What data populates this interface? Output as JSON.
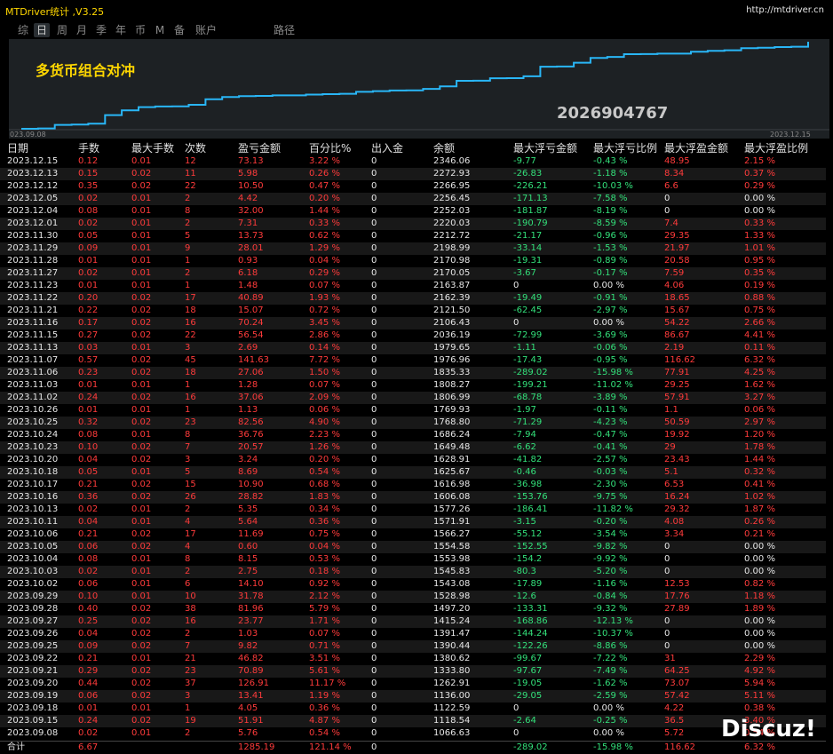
{
  "window": {
    "title": "MTDriver统计 ,V3.25",
    "url": "http://mtdriver.cn"
  },
  "tabs": [
    "综",
    "日",
    "周",
    "月",
    "季",
    "年",
    "币",
    "M",
    "备",
    "账户",
    "路径"
  ],
  "active_tab": "日",
  "chart": {
    "title": "多货币组合对冲",
    "account": "2026904767",
    "start_label": "023.09.08",
    "end_label": "2023.12.15",
    "line_color": "#29b6f6"
  },
  "table": {
    "headers": [
      "日期",
      "手数",
      "最大手数",
      "次数",
      "盈亏金额",
      "百分比%",
      "出入金",
      "余额",
      "最大浮亏金额",
      "最大浮亏比例",
      "最大浮盈金额",
      "最大浮盈比例"
    ],
    "rows": [
      [
        "2023.12.15",
        "0.12",
        "0.01",
        "12",
        "73.13",
        "3.22 %",
        "0",
        "2346.06",
        "-9.77",
        "-0.43 %",
        "48.95",
        "2.15 %"
      ],
      [
        "2023.12.13",
        "0.15",
        "0.02",
        "11",
        "5.98",
        "0.26 %",
        "0",
        "2272.93",
        "-26.83",
        "-1.18 %",
        "8.34",
        "0.37 %"
      ],
      [
        "2023.12.12",
        "0.35",
        "0.02",
        "22",
        "10.50",
        "0.47 %",
        "0",
        "2266.95",
        "-226.21",
        "-10.03 %",
        "6.6",
        "0.29 %"
      ],
      [
        "2023.12.05",
        "0.02",
        "0.01",
        "2",
        "4.42",
        "0.20 %",
        "0",
        "2256.45",
        "-171.13",
        "-7.58 %",
        "0",
        "0.00 %"
      ],
      [
        "2023.12.04",
        "0.08",
        "0.01",
        "8",
        "32.00",
        "1.44 %",
        "0",
        "2252.03",
        "-181.87",
        "-8.19 %",
        "0",
        "0.00 %"
      ],
      [
        "2023.12.01",
        "0.02",
        "0.01",
        "2",
        "7.31",
        "0.33 %",
        "0",
        "2220.03",
        "-190.79",
        "-8.59 %",
        "7.4",
        "0.33 %"
      ],
      [
        "2023.11.30",
        "0.05",
        "0.01",
        "5",
        "13.73",
        "0.62 %",
        "0",
        "2212.72",
        "-21.17",
        "-0.96 %",
        "29.35",
        "1.33 %"
      ],
      [
        "2023.11.29",
        "0.09",
        "0.01",
        "9",
        "28.01",
        "1.29 %",
        "0",
        "2198.99",
        "-33.14",
        "-1.53 %",
        "21.97",
        "1.01 %"
      ],
      [
        "2023.11.28",
        "0.01",
        "0.01",
        "1",
        "0.93",
        "0.04 %",
        "0",
        "2170.98",
        "-19.31",
        "-0.89 %",
        "20.58",
        "0.95 %"
      ],
      [
        "2023.11.27",
        "0.02",
        "0.01",
        "2",
        "6.18",
        "0.29 %",
        "0",
        "2170.05",
        "-3.67",
        "-0.17 %",
        "7.59",
        "0.35 %"
      ],
      [
        "2023.11.23",
        "0.01",
        "0.01",
        "1",
        "1.48",
        "0.07 %",
        "0",
        "2163.87",
        "0",
        "0.00 %",
        "4.06",
        "0.19 %"
      ],
      [
        "2023.11.22",
        "0.20",
        "0.02",
        "17",
        "40.89",
        "1.93 %",
        "0",
        "2162.39",
        "-19.49",
        "-0.91 %",
        "18.65",
        "0.88 %"
      ],
      [
        "2023.11.21",
        "0.22",
        "0.02",
        "18",
        "15.07",
        "0.72 %",
        "0",
        "2121.50",
        "-62.45",
        "-2.97 %",
        "15.67",
        "0.75 %"
      ],
      [
        "2023.11.16",
        "0.17",
        "0.02",
        "16",
        "70.24",
        "3.45 %",
        "0",
        "2106.43",
        "0",
        "0.00 %",
        "54.22",
        "2.66 %"
      ],
      [
        "2023.11.15",
        "0.27",
        "0.02",
        "22",
        "56.54",
        "2.86 %",
        "0",
        "2036.19",
        "-72.99",
        "-3.69 %",
        "86.67",
        "4.41 %"
      ],
      [
        "2023.11.13",
        "0.03",
        "0.01",
        "3",
        "2.69",
        "0.14 %",
        "0",
        "1979.65",
        "-1.11",
        "-0.06 %",
        "2.19",
        "0.11 %"
      ],
      [
        "2023.11.07",
        "0.57",
        "0.02",
        "45",
        "141.63",
        "7.72 %",
        "0",
        "1976.96",
        "-17.43",
        "-0.95 %",
        "116.62",
        "6.32 %"
      ],
      [
        "2023.11.06",
        "0.23",
        "0.02",
        "18",
        "27.06",
        "1.50 %",
        "0",
        "1835.33",
        "-289.02",
        "-15.98 %",
        "77.91",
        "4.25 %"
      ],
      [
        "2023.11.03",
        "0.01",
        "0.01",
        "1",
        "1.28",
        "0.07 %",
        "0",
        "1808.27",
        "-199.21",
        "-11.02 %",
        "29.25",
        "1.62 %"
      ],
      [
        "2023.11.02",
        "0.24",
        "0.02",
        "16",
        "37.06",
        "2.09 %",
        "0",
        "1806.99",
        "-68.78",
        "-3.89 %",
        "57.91",
        "3.27 %"
      ],
      [
        "2023.10.26",
        "0.01",
        "0.01",
        "1",
        "1.13",
        "0.06 %",
        "0",
        "1769.93",
        "-1.97",
        "-0.11 %",
        "1.1",
        "0.06 %"
      ],
      [
        "2023.10.25",
        "0.32",
        "0.02",
        "23",
        "82.56",
        "4.90 %",
        "0",
        "1768.80",
        "-71.29",
        "-4.23 %",
        "50.59",
        "2.97 %"
      ],
      [
        "2023.10.24",
        "0.08",
        "0.01",
        "8",
        "36.76",
        "2.23 %",
        "0",
        "1686.24",
        "-7.94",
        "-0.47 %",
        "19.92",
        "1.20 %"
      ],
      [
        "2023.10.23",
        "0.10",
        "0.02",
        "7",
        "20.57",
        "1.26 %",
        "0",
        "1649.48",
        "-6.62",
        "-0.41 %",
        "29",
        "1.78 %"
      ],
      [
        "2023.10.20",
        "0.04",
        "0.02",
        "3",
        "3.24",
        "0.20 %",
        "0",
        "1628.91",
        "-41.82",
        "-2.57 %",
        "23.43",
        "1.44 %"
      ],
      [
        "2023.10.18",
        "0.05",
        "0.01",
        "5",
        "8.69",
        "0.54 %",
        "0",
        "1625.67",
        "-0.46",
        "-0.03 %",
        "5.1",
        "0.32 %"
      ],
      [
        "2023.10.17",
        "0.21",
        "0.02",
        "15",
        "10.90",
        "0.68 %",
        "0",
        "1616.98",
        "-36.98",
        "-2.30 %",
        "6.53",
        "0.41 %"
      ],
      [
        "2023.10.16",
        "0.36",
        "0.02",
        "26",
        "28.82",
        "1.83 %",
        "0",
        "1606.08",
        "-153.76",
        "-9.75 %",
        "16.24",
        "1.02 %"
      ],
      [
        "2023.10.13",
        "0.02",
        "0.01",
        "2",
        "5.35",
        "0.34 %",
        "0",
        "1577.26",
        "-186.41",
        "-11.82 %",
        "29.32",
        "1.87 %"
      ],
      [
        "2023.10.11",
        "0.04",
        "0.01",
        "4",
        "5.64",
        "0.36 %",
        "0",
        "1571.91",
        "-3.15",
        "-0.20 %",
        "4.08",
        "0.26 %"
      ],
      [
        "2023.10.06",
        "0.21",
        "0.02",
        "17",
        "11.69",
        "0.75 %",
        "0",
        "1566.27",
        "-55.12",
        "-3.54 %",
        "3.34",
        "0.21 %"
      ],
      [
        "2023.10.05",
        "0.06",
        "0.02",
        "4",
        "0.60",
        "0.04 %",
        "0",
        "1554.58",
        "-152.55",
        "-9.82 %",
        "0",
        "0.00 %"
      ],
      [
        "2023.10.04",
        "0.08",
        "0.01",
        "8",
        "8.15",
        "0.53 %",
        "0",
        "1553.98",
        "-154.2",
        "-9.92 %",
        "0",
        "0.00 %"
      ],
      [
        "2023.10.03",
        "0.02",
        "0.01",
        "2",
        "2.75",
        "0.18 %",
        "0",
        "1545.83",
        "-80.3",
        "-5.20 %",
        "0",
        "0.00 %"
      ],
      [
        "2023.10.02",
        "0.06",
        "0.01",
        "6",
        "14.10",
        "0.92 %",
        "0",
        "1543.08",
        "-17.89",
        "-1.16 %",
        "12.53",
        "0.82 %"
      ],
      [
        "2023.09.29",
        "0.10",
        "0.01",
        "10",
        "31.78",
        "2.12 %",
        "0",
        "1528.98",
        "-12.6",
        "-0.84 %",
        "17.76",
        "1.18 %"
      ],
      [
        "2023.09.28",
        "0.40",
        "0.02",
        "38",
        "81.96",
        "5.79 %",
        "0",
        "1497.20",
        "-133.31",
        "-9.32 %",
        "27.89",
        "1.89 %"
      ],
      [
        "2023.09.27",
        "0.25",
        "0.02",
        "16",
        "23.77",
        "1.71 %",
        "0",
        "1415.24",
        "-168.86",
        "-12.13 %",
        "0",
        "0.00 %"
      ],
      [
        "2023.09.26",
        "0.04",
        "0.02",
        "2",
        "1.03",
        "0.07 %",
        "0",
        "1391.47",
        "-144.24",
        "-10.37 %",
        "0",
        "0.00 %"
      ],
      [
        "2023.09.25",
        "0.09",
        "0.02",
        "7",
        "9.82",
        "0.71 %",
        "0",
        "1390.44",
        "-122.26",
        "-8.86 %",
        "0",
        "0.00 %"
      ],
      [
        "2023.09.22",
        "0.21",
        "0.01",
        "21",
        "46.82",
        "3.51 %",
        "0",
        "1380.62",
        "-99.67",
        "-7.22 %",
        "31",
        "2.29 %"
      ],
      [
        "2023.09.21",
        "0.29",
        "0.02",
        "23",
        "70.89",
        "5.61 %",
        "0",
        "1333.80",
        "-97.67",
        "-7.49 %",
        "64.25",
        "4.92 %"
      ],
      [
        "2023.09.20",
        "0.44",
        "0.02",
        "37",
        "126.91",
        "11.17 %",
        "0",
        "1262.91",
        "-19.05",
        "-1.62 %",
        "73.07",
        "5.94 %"
      ],
      [
        "2023.09.19",
        "0.06",
        "0.02",
        "3",
        "13.41",
        "1.19 %",
        "0",
        "1136.00",
        "-29.05",
        "-2.59 %",
        "57.42",
        "5.11 %"
      ],
      [
        "2023.09.18",
        "0.01",
        "0.01",
        "1",
        "4.05",
        "0.36 %",
        "0",
        "1122.59",
        "0",
        "0.00 %",
        "4.22",
        "0.38 %"
      ],
      [
        "2023.09.15",
        "0.24",
        "0.02",
        "19",
        "51.91",
        "4.87 %",
        "0",
        "1118.54",
        "-2.64",
        "-0.25 %",
        "36.5",
        "3.40 %"
      ],
      [
        "2023.09.08",
        "0.02",
        "0.01",
        "2",
        "5.76",
        "0.54 %",
        "0",
        "1066.63",
        "0",
        "0.00 %",
        "5.72",
        "0.54 %"
      ]
    ],
    "total": [
      "合计",
      "6.67",
      "",
      "",
      "1285.19",
      "121.14 %",
      "0",
      "",
      "-289.02",
      "-15.98 %",
      "116.62",
      "6.32 %"
    ]
  },
  "watermark": "Discuz!"
}
